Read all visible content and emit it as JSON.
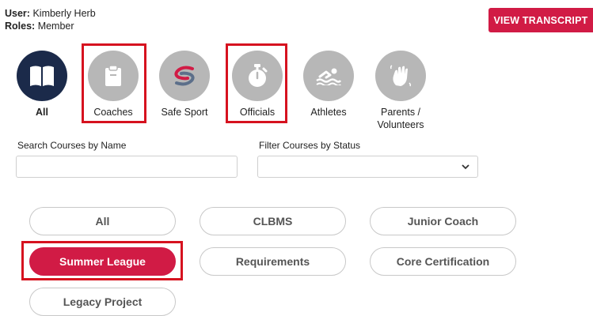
{
  "user": {
    "user_label": "User:",
    "user_name": "Kimberly Herb",
    "roles_label": "Roles:",
    "roles_value": "Member"
  },
  "header": {
    "transcript_button": "VIEW TRANSCRIPT"
  },
  "categories": [
    {
      "label": "All",
      "icon": "book-icon",
      "active": true
    },
    {
      "label": "Coaches",
      "icon": "clipboard-icon",
      "highlighted": true
    },
    {
      "label": "Safe Sport",
      "icon": "safe-sport-logo-icon"
    },
    {
      "label": "Officials",
      "icon": "stopwatch-icon",
      "highlighted": true
    },
    {
      "label": "Athletes",
      "icon": "swimmer-icon"
    },
    {
      "label": "Parents / Volunteers",
      "icon": "waving-hand-icon"
    }
  ],
  "search": {
    "label": "Search Courses by Name",
    "placeholder": "",
    "value": ""
  },
  "filter": {
    "label": "Filter Courses by Status",
    "selected": ""
  },
  "course_groups": [
    {
      "label": "All"
    },
    {
      "label": "CLBMS"
    },
    {
      "label": "Junior Coach"
    },
    {
      "label": "Summer League",
      "selected": true,
      "highlighted": true
    },
    {
      "label": "Requirements"
    },
    {
      "label": "Core Certification"
    },
    {
      "label": "Legacy Project"
    }
  ],
  "colors": {
    "accent": "#d11b45",
    "active_icon": "#1b2a4a",
    "inactive_icon": "#b7b7b7",
    "highlight_box": "#d6121f"
  }
}
